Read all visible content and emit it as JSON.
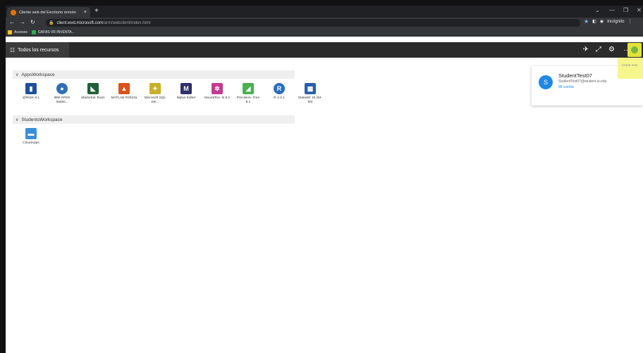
{
  "browser": {
    "tab_title": "Cliente web del Escritorio remoto",
    "url_host": "client.wvd.microsoft.com",
    "url_path": "/arm/webclient/index.html",
    "incognito_label": "Incógnito",
    "bookmarks": [
      "Accesos",
      "GAFAS VR INVENTA..."
    ]
  },
  "app": {
    "title": "Todos los recursos"
  },
  "workspaces": [
    {
      "name": "AppsWorkspace",
      "apps": [
        {
          "label": "@RISK 8.1",
          "color": "#1f4e9c",
          "glyph": "▮"
        },
        {
          "label": "IBM SPSS Statist...",
          "color": "#2f6fb5",
          "glyph": "●"
        },
        {
          "label": "Marketrat Team",
          "color": "#1f5e38",
          "glyph": "◣"
        },
        {
          "label": "MATLAB R2022a",
          "color": "#d9531e",
          "glyph": "▲"
        },
        {
          "label": "Microsoft SQL Ser...",
          "color": "#c9b02a",
          "glyph": "✦"
        },
        {
          "label": "Mplus Editor",
          "color": "#30306a",
          "glyph": "M"
        },
        {
          "label": "NeuralToo- ls 8.1",
          "color": "#c43a8f",
          "glyph": "✲"
        },
        {
          "label": "Precision- Tree 8.1",
          "color": "#4caf50",
          "glyph": "◢"
        },
        {
          "label": "R 4.2.1",
          "color": "#276dc3",
          "glyph": "R"
        },
        {
          "label": "StataSE 16 (64-bit)",
          "color": "#2a5ea8",
          "glyph": "▦"
        }
      ]
    },
    {
      "name": "StudentsWorkspace",
      "apps": [
        {
          "label": "CloudApps",
          "color": "#3a8fd8",
          "glyph": "▬"
        }
      ]
    }
  ],
  "account": {
    "initial": "S",
    "name": "StudentTest07",
    "email": "StudentTest07@student.ie.edu",
    "link": "Mi cuenta",
    "signout": "Cerrar sesi"
  },
  "colors": {
    "browser_dark": "#202124",
    "app_header": "#2b2b2b",
    "highlight": "#e2e23a",
    "accent": "#1e88e5"
  }
}
